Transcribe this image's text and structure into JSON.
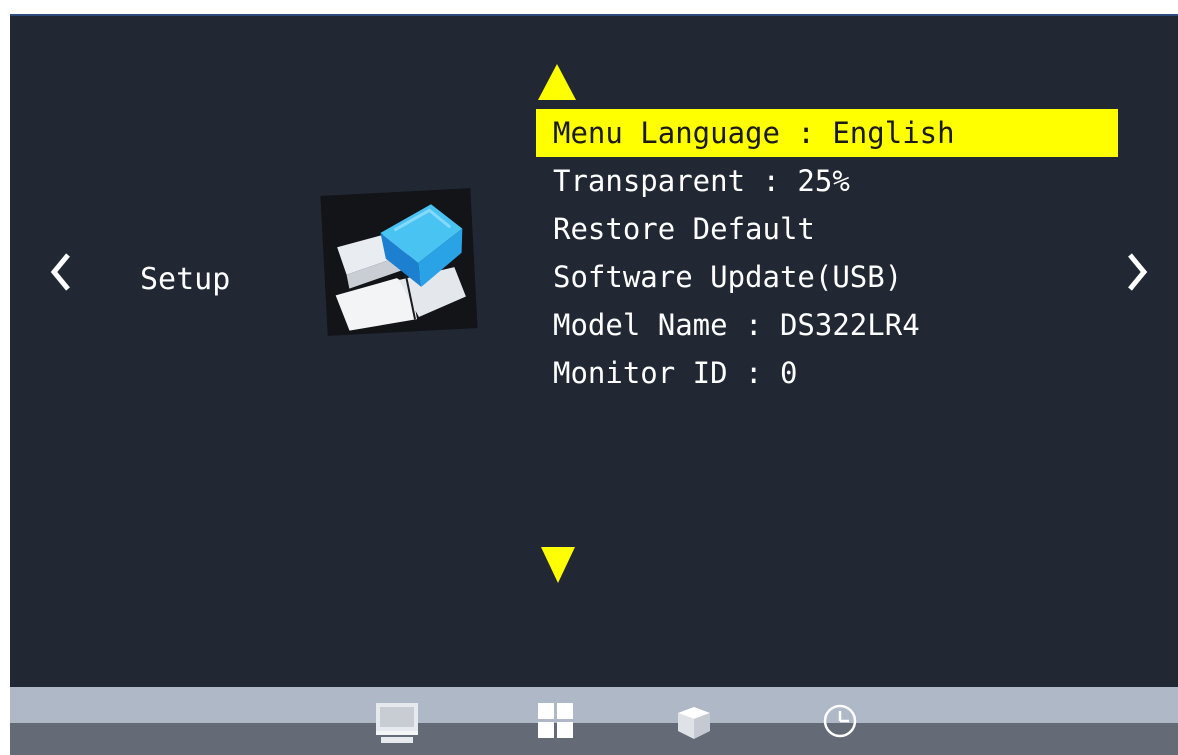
{
  "category": {
    "label": "Setup",
    "icon": "setup-blocks-icon"
  },
  "menu": {
    "items": [
      {
        "label": "Menu Language : English",
        "selected": true
      },
      {
        "label": "Transparent : 25%"
      },
      {
        "label": "Restore Default"
      },
      {
        "label": "Software Update(USB)"
      },
      {
        "label": "Model Name : DS322LR4"
      },
      {
        "label": "Monitor ID : 0"
      }
    ]
  },
  "nav": {
    "prev_icon": "chevron-left-icon",
    "next_icon": "chevron-right-icon",
    "up_icon": "triangle-up-icon",
    "down_icon": "triangle-down-icon"
  },
  "tabs": [
    {
      "icon": "monitor-icon"
    },
    {
      "icon": "grid-icon"
    },
    {
      "icon": "cube-icon"
    },
    {
      "icon": "clock-icon"
    }
  ],
  "colors": {
    "background": "#222833",
    "highlight": "#ffff00",
    "arrow": "#ffff00",
    "bar_light": "#aeb8c6",
    "bar_dark": "#646b76"
  }
}
